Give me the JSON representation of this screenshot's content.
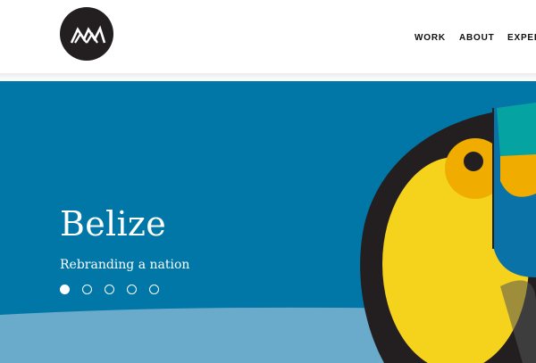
{
  "header": {
    "logo_icon": "mountain-peaks-logo-icon",
    "nav": [
      {
        "label": "WORK"
      },
      {
        "label": "ABOUT"
      },
      {
        "label": "EXPER"
      }
    ]
  },
  "hero": {
    "title": "Belize",
    "subtitle": "Rebranding a nation",
    "slides": {
      "count": 5,
      "active": 1
    },
    "illustration_icon": "toucan-illustration"
  },
  "colors": {
    "hero_blue": "#0077a6",
    "light_blue_band": "#6aaacb",
    "toucan_yellow": "#f5d21c",
    "toucan_orange": "#f0ad00",
    "toucan_teal": "#06a3a3",
    "toucan_black": "#231f20"
  }
}
